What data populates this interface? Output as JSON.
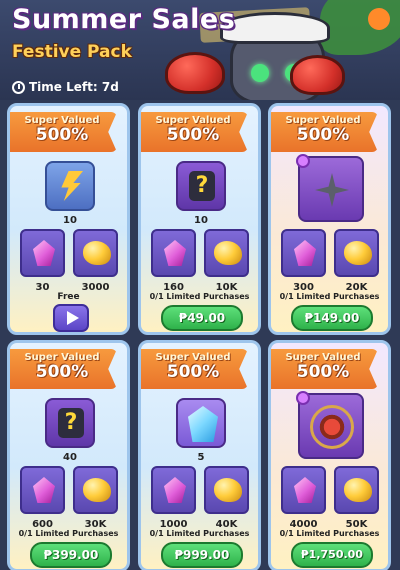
{
  "header": {
    "title": "Summer Sales",
    "subtitle": "Festive Pack",
    "time_left": "Time Left: 7d"
  },
  "cards": [
    {
      "ribbon_top": "Super Valued",
      "ribbon_big": "500%",
      "main_icon": "energy-bolt-icon",
      "main_count": "10",
      "items": [
        {
          "icon": "pink-gem-icon",
          "count": "30"
        },
        {
          "icon": "gold-ore-icon",
          "count": "3000"
        }
      ],
      "footer_label": "Free",
      "button": "play"
    },
    {
      "ribbon_top": "Super Valued",
      "ribbon_big": "500%",
      "main_icon": "mystery-box-icon",
      "main_count": "10",
      "items": [
        {
          "icon": "pink-gem-icon",
          "count": "160"
        },
        {
          "icon": "gold-ore-icon",
          "count": "10K"
        }
      ],
      "footer_label": "0/1 Limited Purchases",
      "price": "₱49.00"
    },
    {
      "ribbon_top": "Super Valued",
      "ribbon_big": "500%",
      "main_icon": "shuriken-icon",
      "main_count": "",
      "items": [
        {
          "icon": "pink-gem-icon",
          "count": "300"
        },
        {
          "icon": "gold-ore-icon",
          "count": "20K"
        }
      ],
      "footer_label": "0/1 Limited Purchases",
      "price": "₱149.00"
    },
    {
      "ribbon_top": "Super Valued",
      "ribbon_big": "500%",
      "main_icon": "mystery-box-icon",
      "main_count": "40",
      "items": [
        {
          "icon": "pink-gem-icon",
          "count": "600"
        },
        {
          "icon": "gold-ore-icon",
          "count": "30K"
        }
      ],
      "footer_label": "0/1 Limited Purchases",
      "price": "₱399.00"
    },
    {
      "ribbon_top": "Super Valued",
      "ribbon_big": "500%",
      "main_icon": "blue-crystal-icon",
      "main_count": "5",
      "items": [
        {
          "icon": "pink-gem-icon",
          "count": "1000"
        },
        {
          "icon": "gold-ore-icon",
          "count": "40K"
        }
      ],
      "footer_label": "0/1 Limited Purchases",
      "price": "₱999.00"
    },
    {
      "ribbon_top": "Super Valued",
      "ribbon_big": "500%",
      "main_icon": "crossbow-icon",
      "main_count": "",
      "items": [
        {
          "icon": "pink-gem-icon",
          "count": "4000"
        },
        {
          "icon": "gold-ore-icon",
          "count": "50K"
        }
      ],
      "footer_label": "0/1 Limited Purchases",
      "price": "₱1,750.00"
    }
  ],
  "colors": {
    "ribbon": "#e9732a",
    "price_button": "#2fb24b",
    "slot_purple": "#5f36a8",
    "title_outline": "#5a2a80",
    "subtitle": "#ffd15a"
  }
}
